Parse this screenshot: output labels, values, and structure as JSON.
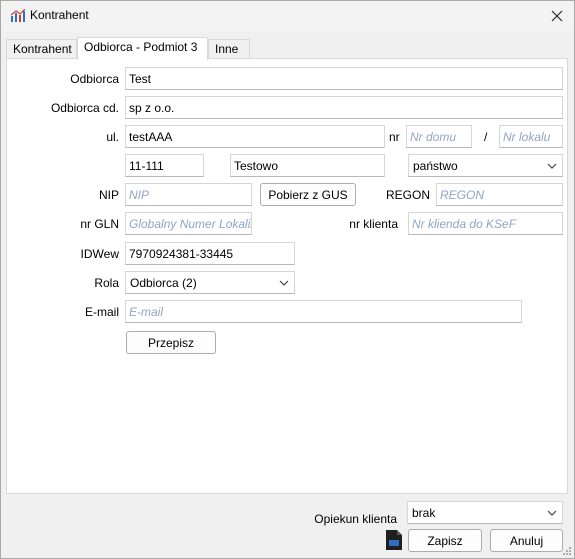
{
  "window": {
    "title": "Kontrahent"
  },
  "tabs": [
    {
      "label": "Kontrahent"
    },
    {
      "label": "Odbiorca - Podmiot 3"
    },
    {
      "label": "Inne"
    }
  ],
  "form": {
    "odbiorca": {
      "label": "Odbiorca",
      "value": "Test"
    },
    "odbiorca_cd": {
      "label": "Odbiorca cd.",
      "value": "sp z o.o."
    },
    "ulica": {
      "label": "ul.",
      "value": "testAAA"
    },
    "nr": {
      "label": "nr",
      "placeholder": "Nr domu"
    },
    "slash": "/",
    "nr_lokalu": {
      "placeholder": "Nr lokalu"
    },
    "kod": {
      "value": "11-111"
    },
    "miasto": {
      "value": "Testowo"
    },
    "panstwo": {
      "value": "państwo"
    },
    "nip": {
      "label": "NIP",
      "placeholder": "NIP"
    },
    "pobierz_button": "Pobierz z GUS",
    "regon": {
      "label": "REGON",
      "placeholder": "REGON"
    },
    "nr_gln": {
      "label": "nr GLN",
      "placeholder": "Globalny Numer Lokaliz"
    },
    "nr_klienta": {
      "label": "nr klienta",
      "placeholder": "Nr klienda do KSeF"
    },
    "idwew": {
      "label": "IDWew",
      "value": "7970924381-33445"
    },
    "rola": {
      "label": "Rola",
      "value": "Odbiorca (2)"
    },
    "email": {
      "label": "E-mail",
      "placeholder": "E-mail"
    },
    "przepisz_button": "Przepisz"
  },
  "footer": {
    "opiekun": {
      "label": "Opiekun klienta",
      "value": "brak"
    },
    "save_button": "Zapisz",
    "cancel_button": "Anuluj"
  }
}
